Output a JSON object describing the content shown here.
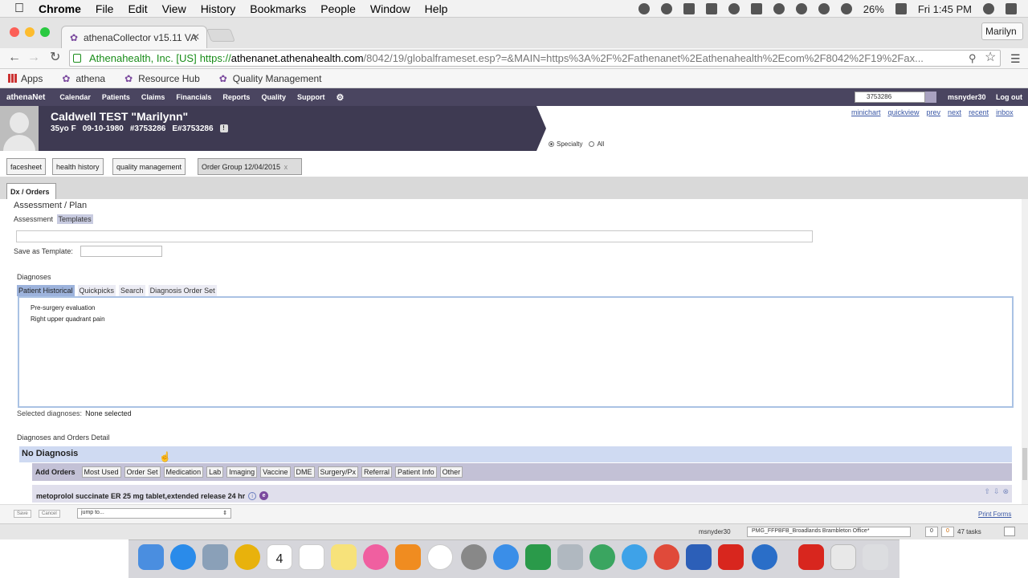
{
  "mac_menubar": {
    "app": "Chrome",
    "items": [
      "File",
      "Edit",
      "View",
      "History",
      "Bookmarks",
      "People",
      "Window",
      "Help"
    ],
    "battery": "26%",
    "clock": "Fri 1:45 PM"
  },
  "browser": {
    "tab_title": "athenaCollector v15.11 VA",
    "user_button": "Marilyn",
    "secure_label": "Athenahealth, Inc. [US]",
    "url_scheme": "https://",
    "url_host": "athenanet.athenahealth.com",
    "url_path": "/8042/19/globalframeset.esp?=&MAIN=https%3A%2F%2Fathenanet%2Eathenahealth%2Ecom%2F8042%2F19%2Fax...",
    "bookmarks": [
      "Apps",
      "athena",
      "Resource Hub",
      "Quality Management"
    ]
  },
  "athena_nav": {
    "logo": "athenaNet",
    "items": [
      "Calendar",
      "Patients",
      "Claims",
      "Financials",
      "Reports",
      "Quality",
      "Support"
    ],
    "search_value": "3753286",
    "username": "msnyder30",
    "logout": "Log out"
  },
  "patient": {
    "name": "Caldwell TEST \"Marilynn\"",
    "age_sex": "35yo F",
    "dob": "09-10-1980",
    "id": "#3753286",
    "eid": "E#3753286",
    "flag": "!"
  },
  "patient_links": [
    "minichart",
    "quickview",
    "prev",
    "next",
    "recent",
    "inbox"
  ],
  "view_filter": {
    "options": [
      "Specialty",
      "All"
    ],
    "selected": "Specialty"
  },
  "subtabs": [
    "facesheet",
    "health history",
    "quality management",
    "Order Group 12/04/2015"
  ],
  "active_subtab_close": "x",
  "section_tab": "Dx / Orders",
  "assessment": {
    "title": "Assessment / Plan",
    "tab_assessment": "Assessment",
    "tab_templates": "Templates",
    "save_as_label": "Save as Template:"
  },
  "diagnoses": {
    "title": "Diagnoses",
    "tabs": [
      "Patient Historical",
      "Quickpicks",
      "Search",
      "Diagnosis Order Set"
    ],
    "active_tab": "Patient Historical",
    "items": [
      "Pre-surgery evaluation",
      "Right upper quadrant pain"
    ],
    "selected_label": "Selected diagnoses:",
    "selected_value": "None selected"
  },
  "orders_detail": {
    "title": "Diagnoses and Orders Detail",
    "group": "No Diagnosis",
    "add_label": "Add Orders",
    "buttons": [
      "Most Used",
      "Order Set",
      "Medication",
      "Lab",
      "Imaging",
      "Vaccine",
      "DME",
      "Surgery/Px",
      "Referral",
      "Patient Info",
      "Other"
    ],
    "medication": "metoprolol succinate ER 25 mg tablet,extended release 24 hr",
    "info_glyph": "i",
    "e_glyph": "e"
  },
  "footer": {
    "save": "Save",
    "cancel": "Cancel",
    "jump_to": "jump to...",
    "print_forms": "Print Forms"
  },
  "status": {
    "user": "msnyder30",
    "department": "PMG_FFPBFB_Broadlands Brambleton Office*",
    "count_a": "0",
    "count_b": "0",
    "tasks": "47 tasks"
  },
  "dock": {
    "calendar_day": "4",
    "calendar_month": "DEC"
  }
}
